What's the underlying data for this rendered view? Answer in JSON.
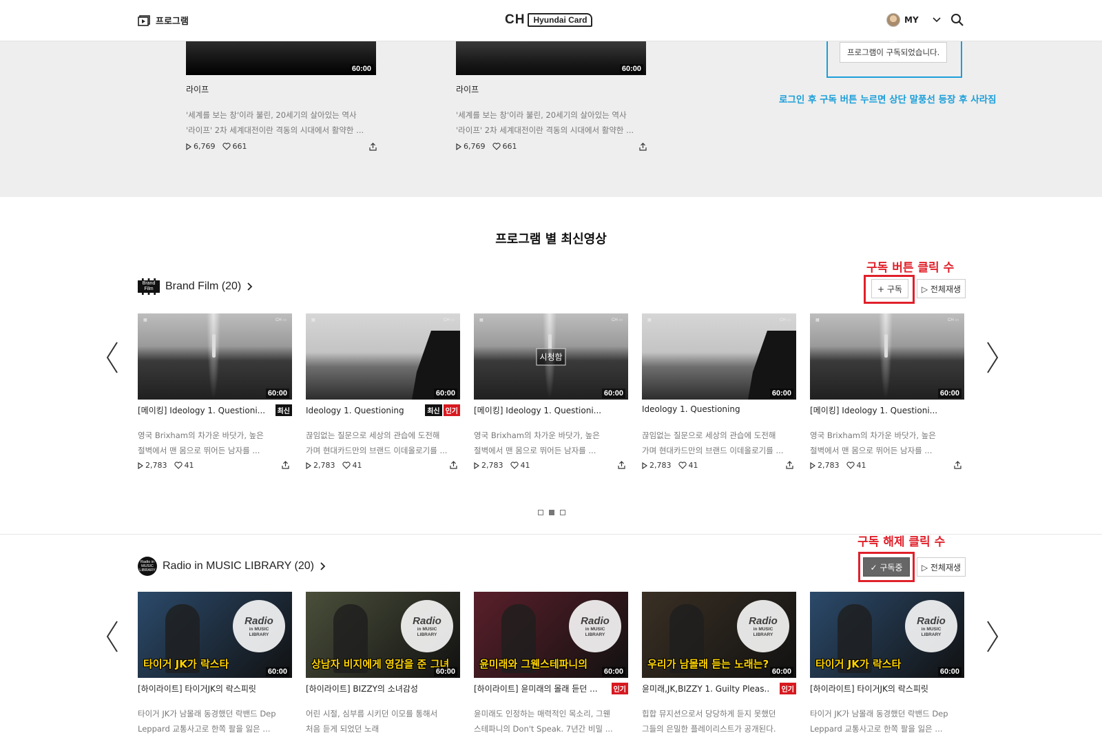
{
  "header": {
    "program_label": "프로그램",
    "logo_ch": "CH",
    "logo_brand": "Hyundai Card",
    "my_label": "MY"
  },
  "toast": {
    "message": "프로그램이 구독되었습니다.",
    "annotation": "로그인 후 구독 버튼 누르면 상단 말풍선 등장 후 사라짐"
  },
  "top_cards": [
    {
      "duration": "60:00",
      "title": "라이프",
      "desc1": "'세계를 보는 창'이라 불린, 20세기의 살아있는 역사",
      "desc2": "'라이프' 2차 세계대전이란 격동의 시대에서 활약한 ...",
      "views": "6,769",
      "likes": "661"
    },
    {
      "duration": "60:00",
      "title": "라이프",
      "desc1": "'세계를 보는 창'이라 불린, 20세기의 살아있는 역사",
      "desc2": "'라이프' 2차 세계대전이란 격동의 시대에서 활약한 ...",
      "views": "6,769",
      "likes": "661"
    }
  ],
  "section_title": "프로그램 별 최신영상",
  "rows": [
    {
      "title": "Brand Film (20)",
      "logo_text": "Brand Film",
      "subscribe_label": "+ 구독",
      "play_all_label": "▷ 전체재생",
      "annotation": "구독 버튼 클릭 수",
      "cards": [
        {
          "duration": "60:00",
          "title": "[메이킹] Ideology 1. Questioni...",
          "badges": [
            "최신"
          ],
          "desc1": "영국 Brixham의 차가운 바닷가, 높은",
          "desc2": "절벽에서 맨 몸으로 뛰어든 남자를 ...",
          "views": "2,783",
          "likes": "41",
          "thumb": "diver"
        },
        {
          "duration": "60:00",
          "title": "Ideology 1. Questioning",
          "badges": [
            "최신",
            "인기"
          ],
          "desc1": "끊임없는 질문으로 세상의 관습에 도전해",
          "desc2": "가며 현대카드만의 브랜드 이데올로기를 ...",
          "views": "2,783",
          "likes": "41",
          "thumb": "cliff"
        },
        {
          "duration": "60:00",
          "title": "[메이킹] Ideology 1. Questioni...",
          "badges": [],
          "desc1": "영국 Brixham의 차가운 바닷가, 높은",
          "desc2": "절벽에서 맨 몸으로 뛰어든 남자를 ...",
          "views": "2,783",
          "likes": "41",
          "thumb": "diver",
          "watched": "시청함"
        },
        {
          "duration": "60:00",
          "title": "Ideology 1. Questioning",
          "badges": [],
          "desc1": "끊임없는 질문으로 세상의 관습에 도전해",
          "desc2": "가며 현대카드만의 브랜드 이데올로기를 ...",
          "views": "2,783",
          "likes": "41",
          "thumb": "cliff"
        },
        {
          "duration": "60:00",
          "title": "[메이킹] Ideology 1. Questioni...",
          "badges": [],
          "desc1": "영국 Brixham의 차가운 바닷가, 높은",
          "desc2": "절벽에서 맨 몸으로 뛰어든 남자를 ...",
          "views": "2,783",
          "likes": "41",
          "thumb": "diver"
        }
      ]
    },
    {
      "title": "Radio in MUSIC LIBRARY (20)",
      "logo_text": "Radio in MUSIC LIBRARY",
      "subscribe_label": "✓ 구독중",
      "play_all_label": "▷ 전체재생",
      "annotation": "구독 해제 클릭 수",
      "cards": [
        {
          "duration": "60:00",
          "title": "[하이라이트] 타이거JK의 락스피릿",
          "badges": [],
          "desc1": "타이거 JK가 남몰래 동경했던 락밴드 Dep",
          "desc2": "Leppard 교통사고로 한쪽 팔을 잃은 ...",
          "overlay": "타이거 JK가 락스타",
          "bg": "#2b4a6b"
        },
        {
          "duration": "60:00",
          "title": "[하이라이트] BIZZY의 소녀감성",
          "badges": [],
          "desc1": "어린 시절, 심부름 시키던 이모를 통해서",
          "desc2": "처음 듣게 되었던 노래",
          "overlay": "상남자 비지에게 영감을 준 그녀",
          "bg": "#4a4f3a"
        },
        {
          "duration": "60:00",
          "title": "[하이라이트] 윤미래의 몰래 듣던 ...",
          "badges": [
            "인기"
          ],
          "desc1": "윤미래도 인정하는 매력적인 목소리, 그웬",
          "desc2": "스테파니의 Don't Speak. 7년간 비밀 ...",
          "overlay": "윤미래와 그웬스테파니의",
          "bg": "#5a1f2a"
        },
        {
          "duration": "60:00",
          "title": "윤미래,JK,BIZZY 1. Guilty Pleas..",
          "badges": [
            "인기"
          ],
          "desc1": "힙합 뮤지션으로서 당당하게 듣지 못했던",
          "desc2": "그들의 은밀한 플레이리스트가 공개된다.",
          "overlay": "우리가 남몰래 듣는 노래는?",
          "bg": "#3a3024"
        },
        {
          "duration": "60:00",
          "title": "[하이라이트] 타이거JK의 락스피릿",
          "badges": [],
          "desc1": "타이거 JK가 남몰래 동경했던 락밴드 Dep",
          "desc2": "Leppard 교통사고로 한쪽 팔을 잃은 ...",
          "overlay": "타이거 JK가 락스타",
          "bg": "#2b4a6b"
        }
      ]
    }
  ],
  "radio_disc": {
    "line1": "Radio",
    "line2": "in MUSIC",
    "line3": "LIBRARY"
  },
  "pagination": {
    "total": 3,
    "current": 2
  }
}
